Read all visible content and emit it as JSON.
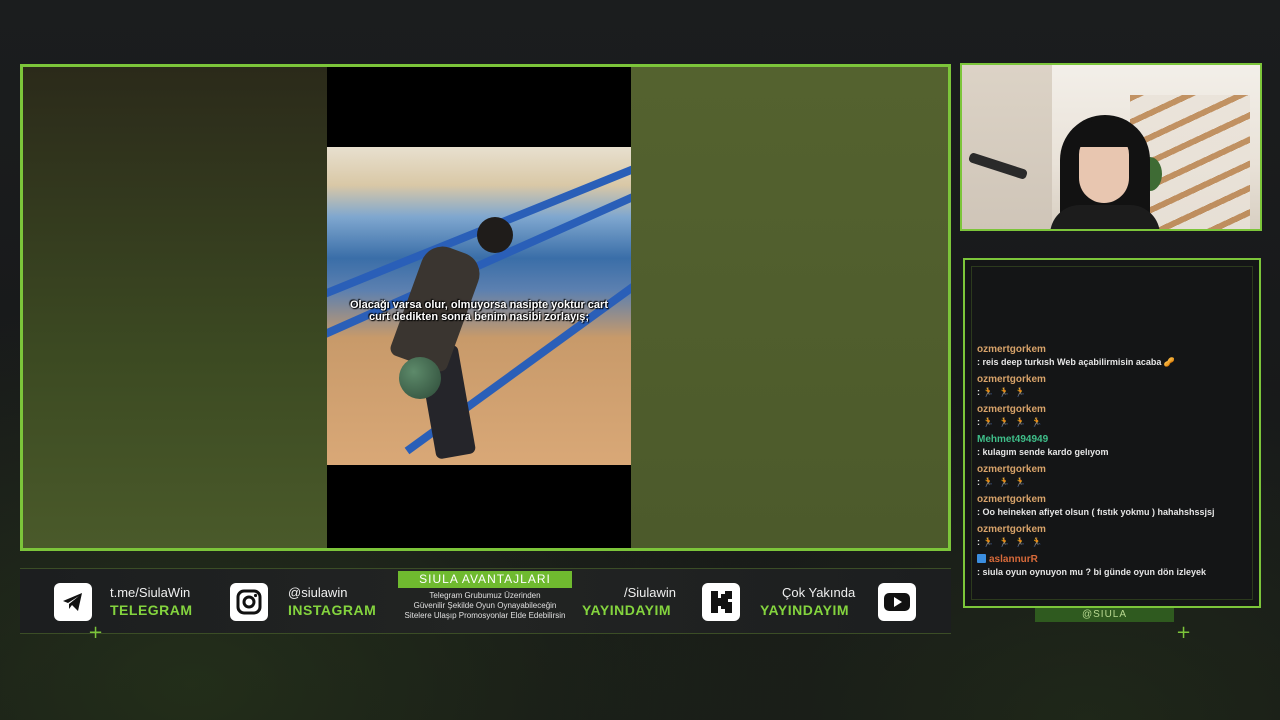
{
  "video": {
    "caption": "Olacağı varsa olur, olmuyorsa nasipte yoktur cart curt dedikten sonra benim nasibi zorlayış;"
  },
  "chat": {
    "messages": [
      {
        "user": "ozmertgorkem",
        "user_color": "#d8a36a",
        "text": ": reis deep turkısh Web açabilirmisin acaba 🥜",
        "emotes": false
      },
      {
        "user": "ozmertgorkem",
        "user_color": "#d8a36a",
        "text": ": ",
        "emotes": true,
        "emote_count": 3
      },
      {
        "user": "ozmertgorkem",
        "user_color": "#d8a36a",
        "text": ": ",
        "emotes": true,
        "emote_count": 4
      },
      {
        "user": "Mehmet494949",
        "user_color": "#3fbf8a",
        "text": ": kulagım sende kardo gelıyom",
        "emotes": false
      },
      {
        "user": "ozmertgorkem",
        "user_color": "#d8a36a",
        "text": ": ",
        "emotes": true,
        "emote_count": 3
      },
      {
        "user": "ozmertgorkem",
        "user_color": "#d8a36a",
        "text": ": Oo heineken afiyet olsun ( fıstık yokmu ) hahahshssjsj",
        "emotes": false
      },
      {
        "user": "ozmertgorkem",
        "user_color": "#d8a36a",
        "text": ": ",
        "emotes": true,
        "emote_count": 4
      },
      {
        "user": "aslannurR",
        "user_color": "#d86a3a",
        "text": ": siula oyun oynuyon mu ? bi günde oyun dön izleyek",
        "emotes": false,
        "role_icon": true
      }
    ],
    "handle": "@SIULA"
  },
  "social": {
    "telegram": {
      "handle": "t.me/SiulaWin",
      "platform": "TELEGRAM",
      "icon": "telegram-icon"
    },
    "instagram": {
      "handle": "@siulawin",
      "platform": "INSTAGRAM",
      "icon": "instagram-icon"
    },
    "promo": {
      "title": "SIULA AVANTAJLARI",
      "line1": "Telegram Grubumuz Üzerinden",
      "line2": "Güvenilir Şekilde Oyun Oynayabileceğin",
      "line3": "Sitelere Ulaşıp Promosyonlar Elde Edebilirsin"
    },
    "kick": {
      "handle": "/Siulawin",
      "platform": "YAYINDAYIM",
      "icon": "kick-icon"
    },
    "youtube": {
      "handle": "Çok Yakında",
      "platform": "YAYINDAYIM",
      "icon": "youtube-icon"
    }
  },
  "colors": {
    "accent": "#7cc53a",
    "platform_text": "#84d43e",
    "background": "#17191a"
  }
}
